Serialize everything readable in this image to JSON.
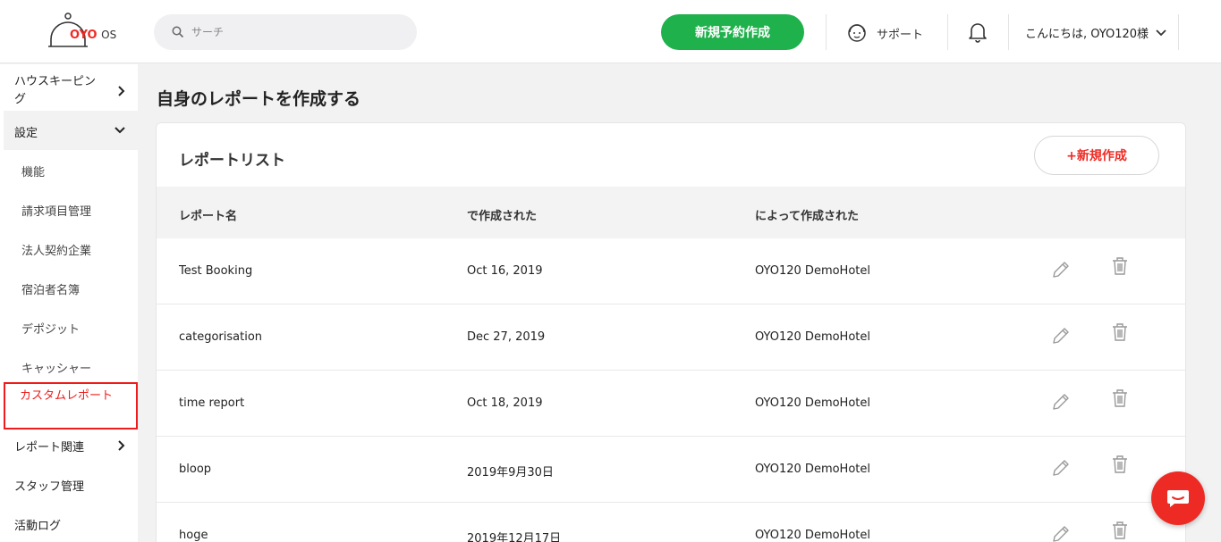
{
  "header": {
    "logo_brand": "OYO",
    "logo_suffix": "OS",
    "search_placeholder": "サーチ",
    "new_booking_label": "新規予約作成",
    "support_label": "サポート",
    "greeting": "こんにちは, OYO120様"
  },
  "sidebar": {
    "housekeeping": "ハウスキーピング",
    "settings": "設定",
    "sub_items": [
      "機能",
      "請求項目管理",
      "法人契約企業",
      "宿泊者名簿",
      "デポジット",
      "キャッシャー"
    ],
    "active_item": "カスタムレポート",
    "report_related": "レポート関連",
    "staff_management": "スタッフ管理",
    "activity_log": "活動ログ"
  },
  "main": {
    "page_title": "自身のレポートを作成する",
    "card_title": "レポートリスト",
    "create_label": "+新規作成",
    "columns": [
      "レポート名",
      "で作成された",
      "によって作成された"
    ],
    "rows": [
      {
        "name": "Test Booking",
        "created": "Oct 16, 2019",
        "by": "OYO120 DemoHotel"
      },
      {
        "name": "categorisation",
        "created": "Dec 27, 2019",
        "by": "OYO120 DemoHotel"
      },
      {
        "name": "time report",
        "created": "Oct 18, 2019",
        "by": "OYO120 DemoHotel"
      },
      {
        "name": "bloop",
        "created": "2019年9月30日",
        "by": "OYO120 DemoHotel"
      },
      {
        "name": "hoge",
        "created": "2019年12月17日",
        "by": "OYO120 DemoHotel"
      }
    ]
  },
  "colors": {
    "brand_red": "#ee2a24",
    "primary_green": "#1fb14c",
    "highlight_red": "#ee1c1c"
  }
}
